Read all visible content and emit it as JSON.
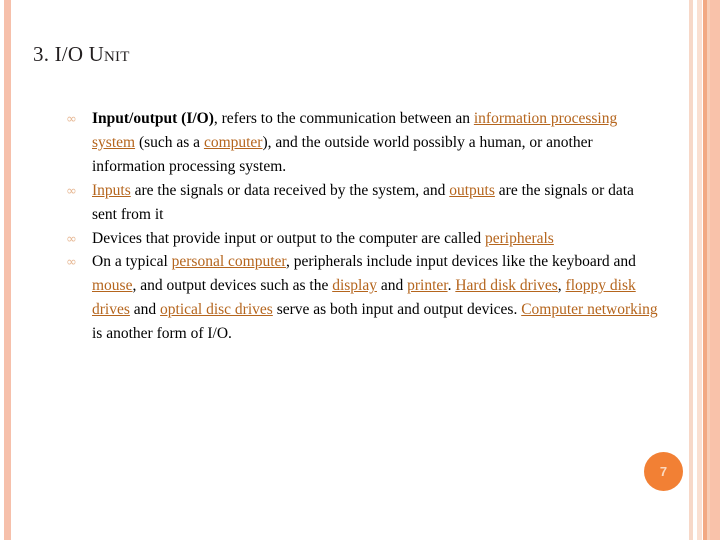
{
  "slide": {
    "title": "3. I/O Unit",
    "background_color": "#ffffff",
    "page_number": "7",
    "bullet_glyph": "∞",
    "colors": {
      "link": "#b5651d",
      "bullet": "#e7b894",
      "badge_background": "#f28034",
      "badge_text": "#fbd9bf",
      "title_text": "#231f20",
      "body_text": "#000000",
      "stripe_left": "#f6c0ab",
      "stripe_right_light": "#f7d8c8",
      "stripe_right_mid": "#fae0d2",
      "stripe_right_dark": "#f2a983",
      "stripe_right_outer": "#f9c2aa"
    },
    "bullets": [
      {
        "id": "bullet-io-definition",
        "segments": [
          {
            "text": "Input/output (I/O)",
            "style": "bold"
          },
          {
            "text": ", refers to the communication between an ",
            "style": "plain"
          },
          {
            "text": "information processing system",
            "style": "link"
          },
          {
            "text": " (such as a ",
            "style": "plain"
          },
          {
            "text": "computer",
            "style": "link"
          },
          {
            "text": "), and the outside world possibly a human, or another information processing system.",
            "style": "plain"
          }
        ]
      },
      {
        "id": "bullet-inputs-outputs",
        "segments": [
          {
            "text": "Inputs",
            "style": "link"
          },
          {
            "text": " are the signals or data received by the system, and ",
            "style": "plain"
          },
          {
            "text": "outputs",
            "style": "link"
          },
          {
            "text": " are the signals or data sent from it",
            "style": "plain"
          }
        ]
      },
      {
        "id": "bullet-peripherals",
        "segments": [
          {
            "text": "Devices that provide input or output to the computer are called ",
            "style": "plain"
          },
          {
            "text": "peripherals",
            "style": "link"
          }
        ]
      },
      {
        "id": "bullet-typical-pc",
        "segments": [
          {
            "text": "On a typical ",
            "style": "plain"
          },
          {
            "text": "personal computer",
            "style": "link"
          },
          {
            "text": ", peripherals include input devices like the keyboard and ",
            "style": "plain"
          },
          {
            "text": "mouse",
            "style": "link"
          },
          {
            "text": ", and output devices such as the ",
            "style": "plain"
          },
          {
            "text": "display",
            "style": "link"
          },
          {
            "text": " and ",
            "style": "plain"
          },
          {
            "text": "printer",
            "style": "link"
          },
          {
            "text": ". ",
            "style": "plain"
          },
          {
            "text": "Hard disk drives",
            "style": "link"
          },
          {
            "text": ", ",
            "style": "plain"
          },
          {
            "text": "floppy disk drives",
            "style": "link"
          },
          {
            "text": " and ",
            "style": "plain"
          },
          {
            "text": "optical disc drives",
            "style": "link"
          },
          {
            "text": " serve as both input and output devices. ",
            "style": "plain"
          },
          {
            "text": "Computer networking",
            "style": "link"
          },
          {
            "text": " is another form of I/O.",
            "style": "plain"
          }
        ]
      }
    ]
  }
}
